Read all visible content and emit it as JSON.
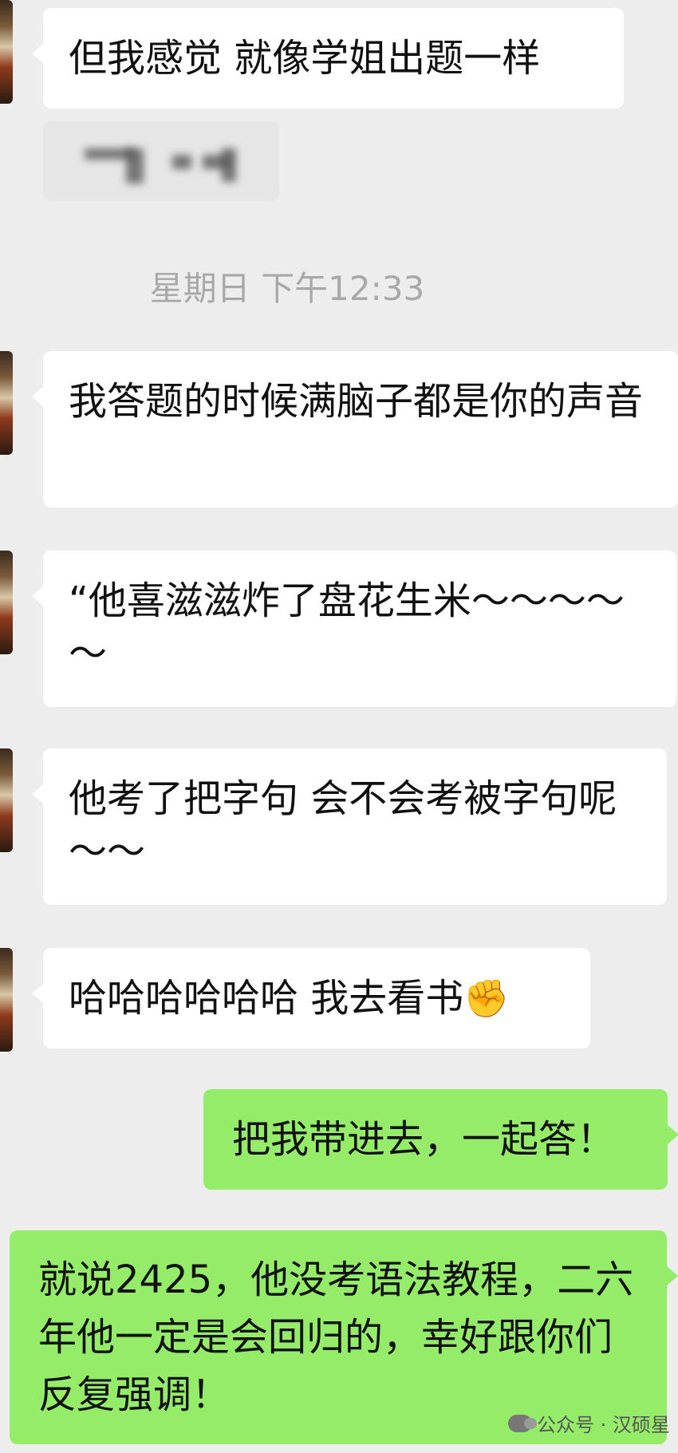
{
  "chat": {
    "timestamp": "星期日 下午12:33",
    "messages": [
      {
        "side": "in",
        "text": "但我感觉 就像学姐出题一样"
      },
      {
        "side": "in",
        "text": "我答题的时候满脑子都是你的声音"
      },
      {
        "side": "in",
        "text": "“他喜滋滋炸了盘花生米～～～～～"
      },
      {
        "side": "in",
        "text": "他考了把字句 会不会考被字句呢～～"
      },
      {
        "side": "in",
        "text": "哈哈哈哈哈哈 我去看书"
      },
      {
        "side": "out",
        "text": "把我带进去，一起答！"
      },
      {
        "side": "out",
        "text": "就说2425，他没考语法教程，二六年他一定是会回归的，幸好跟你们反复强调！"
      }
    ],
    "emoji": "✊"
  },
  "watermark": {
    "icon": "wechat-icon",
    "text": "公众号 · 汉硕星"
  },
  "colors": {
    "background": "#ededed",
    "incoming_bubble": "#ffffff",
    "outgoing_bubble": "#95ec69"
  }
}
